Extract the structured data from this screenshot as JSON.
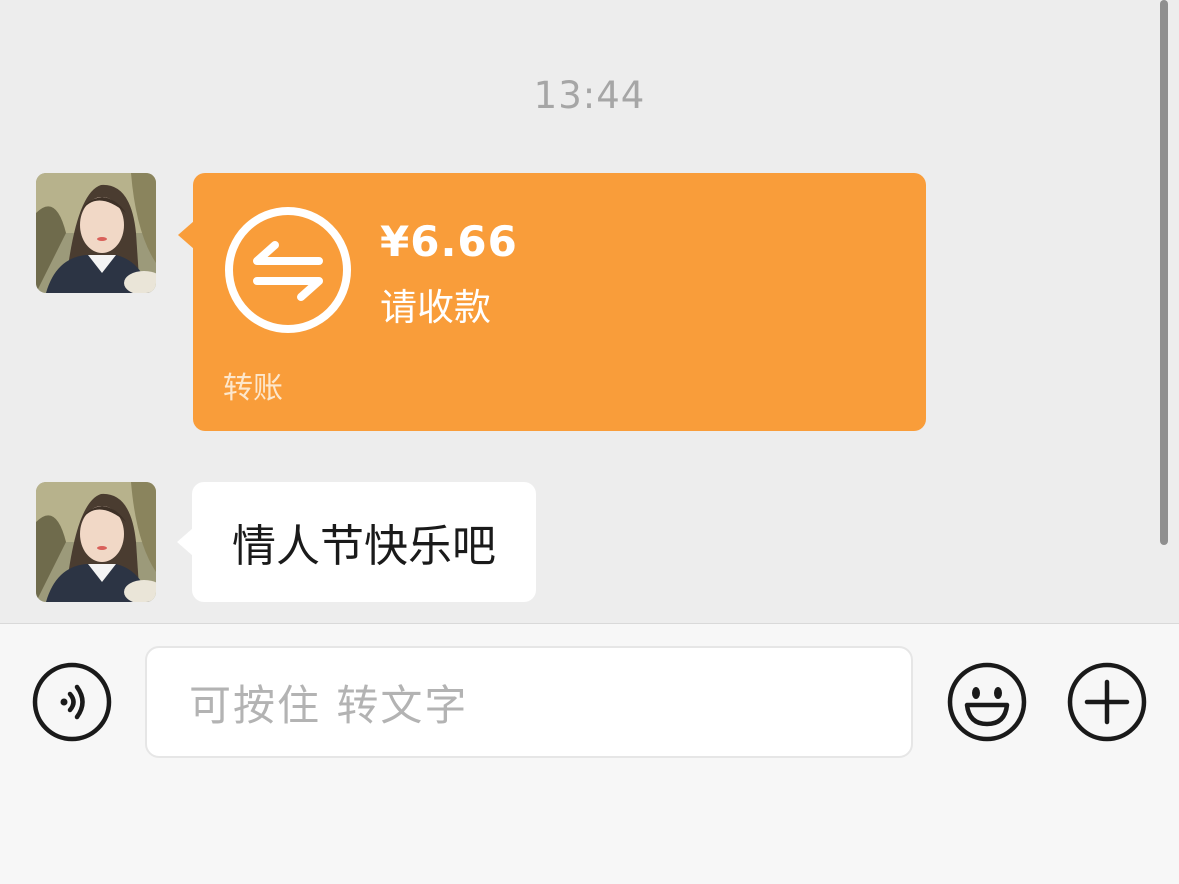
{
  "chat": {
    "timestamp": "13:44",
    "transfer": {
      "amount": "¥6.66",
      "status": "请收款",
      "footer": "转账",
      "icon": "transfer-arrows-icon",
      "color": "#f99d3a"
    },
    "message": {
      "text": "情人节快乐吧"
    }
  },
  "input_bar": {
    "placeholder": "可按住 转文字",
    "voice_icon": "voice-icon",
    "emoji_icon": "emoji-icon",
    "plus_icon": "plus-icon"
  }
}
